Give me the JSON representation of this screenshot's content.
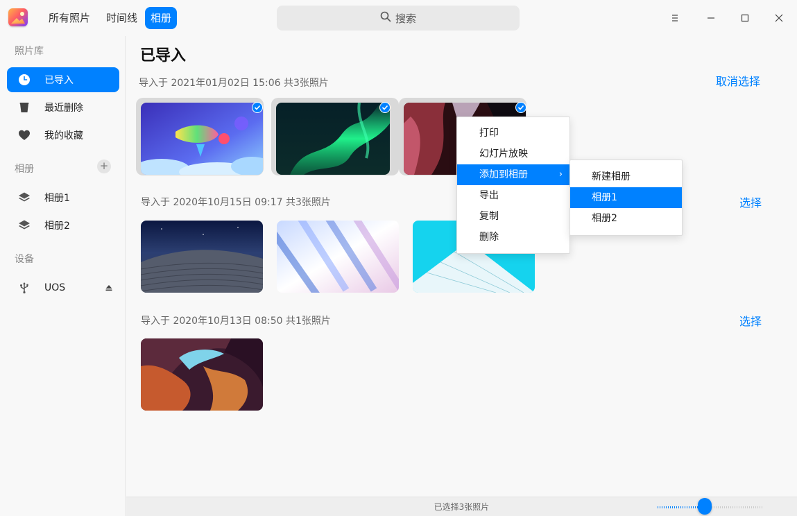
{
  "titlebar": {
    "tabs": [
      "所有照片",
      "时间线",
      "相册"
    ],
    "active_tab": "相册",
    "search_placeholder": "搜索"
  },
  "sidebar": {
    "library_label": "照片库",
    "library_items": [
      {
        "label": "已导入",
        "icon": "clock-icon",
        "active": true
      },
      {
        "label": "最近删除",
        "icon": "trash-icon"
      },
      {
        "label": "我的收藏",
        "icon": "heart-icon"
      }
    ],
    "albums_label": "相册",
    "albums": [
      {
        "label": "相册1",
        "icon": "layers-icon"
      },
      {
        "label": "相册2",
        "icon": "layers-icon"
      }
    ],
    "devices_label": "设备",
    "devices": [
      {
        "label": "UOS",
        "icon": "usb-icon"
      }
    ]
  },
  "main": {
    "title": "已导入",
    "groups": [
      {
        "header": "导入于 2021年01月02日 15:06 共3张照片",
        "action": "取消选择",
        "selected": true
      },
      {
        "header": "导入于 2020年10月15日 09:17 共3张照片",
        "action": "选择"
      },
      {
        "header": "导入于 2020年10月13日 08:50 共1张照片",
        "action": "选择"
      }
    ]
  },
  "context_menu": {
    "items": [
      "打印",
      "幻灯片放映",
      "添加到相册",
      "导出",
      "复制",
      "删除"
    ],
    "highlighted": "添加到相册",
    "submenu": {
      "items": [
        "新建相册",
        "相册1",
        "相册2"
      ],
      "highlighted": "相册1"
    }
  },
  "statusbar": {
    "text": "已选择3张照片",
    "zoom": 0.45
  },
  "colors": {
    "accent": "#0081ff"
  }
}
